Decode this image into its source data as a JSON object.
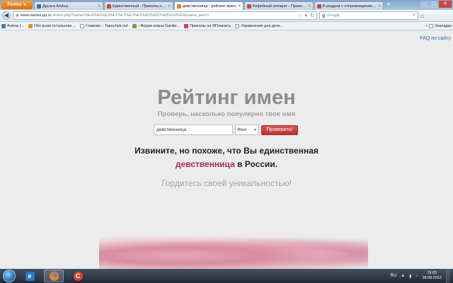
{
  "browser": {
    "firefox_label": "Firefox",
    "tabs": [
      {
        "label": "Друзья Алёны",
        "active": false
      },
      {
        "label": "Единственный - Приколы н...",
        "active": false
      },
      {
        "label": "девственница - рейтинг имен",
        "active": true
      },
      {
        "label": "Кофейный аппарат - Прико...",
        "active": false
      },
      {
        "label": "В роддом с сопровождение...",
        "active": false
      }
    ],
    "url_host": "www.names.pp.ru",
    "url_path": "/index.php?name=%E4%E5%E2%F1%F2%E2%E5%ED%ED%E8%F6%E0&name_sex=1",
    "search_engine": "Google",
    "bookmarks": [
      {
        "label": "Алёна |...",
        "icon": "vk"
      },
      {
        "label": "Обо всем остальном ...",
        "icon": "or"
      },
      {
        "label": "Главная :: Tapochek.net",
        "icon": "pa"
      },
      {
        "label": "- Форум клана Garder...",
        "icon": "gr"
      },
      {
        "label": "Приколы на ЯПлакалъ",
        "icon": "rd"
      },
      {
        "label": "Упражнения для дете...",
        "icon": "pa"
      }
    ],
    "bookmarks_menu_label": "Закладки"
  },
  "page": {
    "faq_link": "FAQ по сайту",
    "title": "Рейтинг имен",
    "subtitle": "Проверь, насколько популярно твое имя",
    "form": {
      "name_value": "девственница",
      "gender_value": "Жен",
      "submit_label": "Проверить!"
    },
    "result_line1": "Извините, но похоже, что Вы единственная",
    "result_name": "девственница",
    "result_suffix": " в России.",
    "proud_text": "Гордитесь своей уникальностью!"
  },
  "taskbar": {
    "language": "RU",
    "time": "19:03",
    "date": "28.08.2012"
  },
  "colors": {
    "accent_red": "#c9403c",
    "name_highlight": "#a3295e",
    "link_blue": "#2a70b8"
  }
}
